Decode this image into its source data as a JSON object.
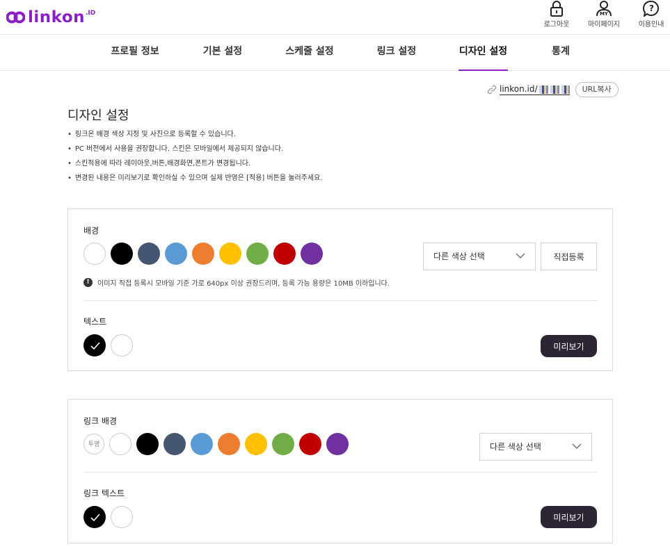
{
  "header": {
    "logo_text": "linkon",
    "logo_sup": ".ID",
    "actions": [
      {
        "label": "로그아웃",
        "icon": "lock-icon"
      },
      {
        "label": "마이페이지",
        "icon": "user-icon"
      },
      {
        "label": "이용인내",
        "icon": "help-icon"
      }
    ]
  },
  "nav": {
    "tabs": [
      {
        "label": "프로필 정보",
        "active": false
      },
      {
        "label": "기본 설정",
        "active": false
      },
      {
        "label": "스케줄 설정",
        "active": false
      },
      {
        "label": "링크 설정",
        "active": false
      },
      {
        "label": "디자인 설정",
        "active": true
      },
      {
        "label": "통계",
        "active": false
      }
    ]
  },
  "url": {
    "text": "linkon.id/",
    "copy_label": "URL복사"
  },
  "page": {
    "title": "디자인 설정",
    "notes": [
      "링크온 배경 색상 지정 및 사진으로 등록할 수 있습니다.",
      "PC 버전에서 사용을 권장합니다. 스킨은 모바일에서 제공되지 않습니다.",
      "스킨적용에 따라 레이아웃,버튼,배경화면,폰트가 변경됩니다.",
      "변경된 내용은 미리보기로 확인하실 수 있으며 실제 반영은 [적용] 버튼을 눌러주세요."
    ]
  },
  "palette": {
    "white": "#ffffff",
    "black": "#000000",
    "slate": "#455671",
    "blue": "#5b9bd5",
    "orange": "#ed7d31",
    "yellow": "#ffc000",
    "green": "#70ad47",
    "red": "#c00000",
    "purple": "#7030a0"
  },
  "panel1": {
    "bg_label": "배경",
    "bg_colors": [
      "#ffffff",
      "#000000",
      "#455671",
      "#5b9bd5",
      "#ed7d31",
      "#ffc000",
      "#70ad47",
      "#c00000",
      "#7030a0"
    ],
    "select_label": "다른 색상 선택",
    "register_label": "직접등록",
    "info_text": "이미지 직접 등록시 모바일 기준 가로 640px 이상 권장드리며, 등록 가능 용량은 10MB 이하입니다.",
    "text_label": "텍스트",
    "text_colors": [
      "#000000",
      "#ffffff"
    ],
    "text_selected": 0,
    "preview_label": "미리보기"
  },
  "panel2": {
    "bg_label": "링크 배경",
    "transparent_label": "투명",
    "bg_colors": [
      "#ffffff",
      "#000000",
      "#455671",
      "#5b9bd5",
      "#ed7d31",
      "#ffc000",
      "#70ad47",
      "#c00000",
      "#7030a0"
    ],
    "select_label": "다른 색상 선택",
    "text_label": "링크 텍스트",
    "text_colors": [
      "#000000",
      "#ffffff"
    ],
    "text_selected": 0,
    "preview_label": "미리보기"
  },
  "accent": "#8a1fc4",
  "preview_button_color": "#2d2534"
}
